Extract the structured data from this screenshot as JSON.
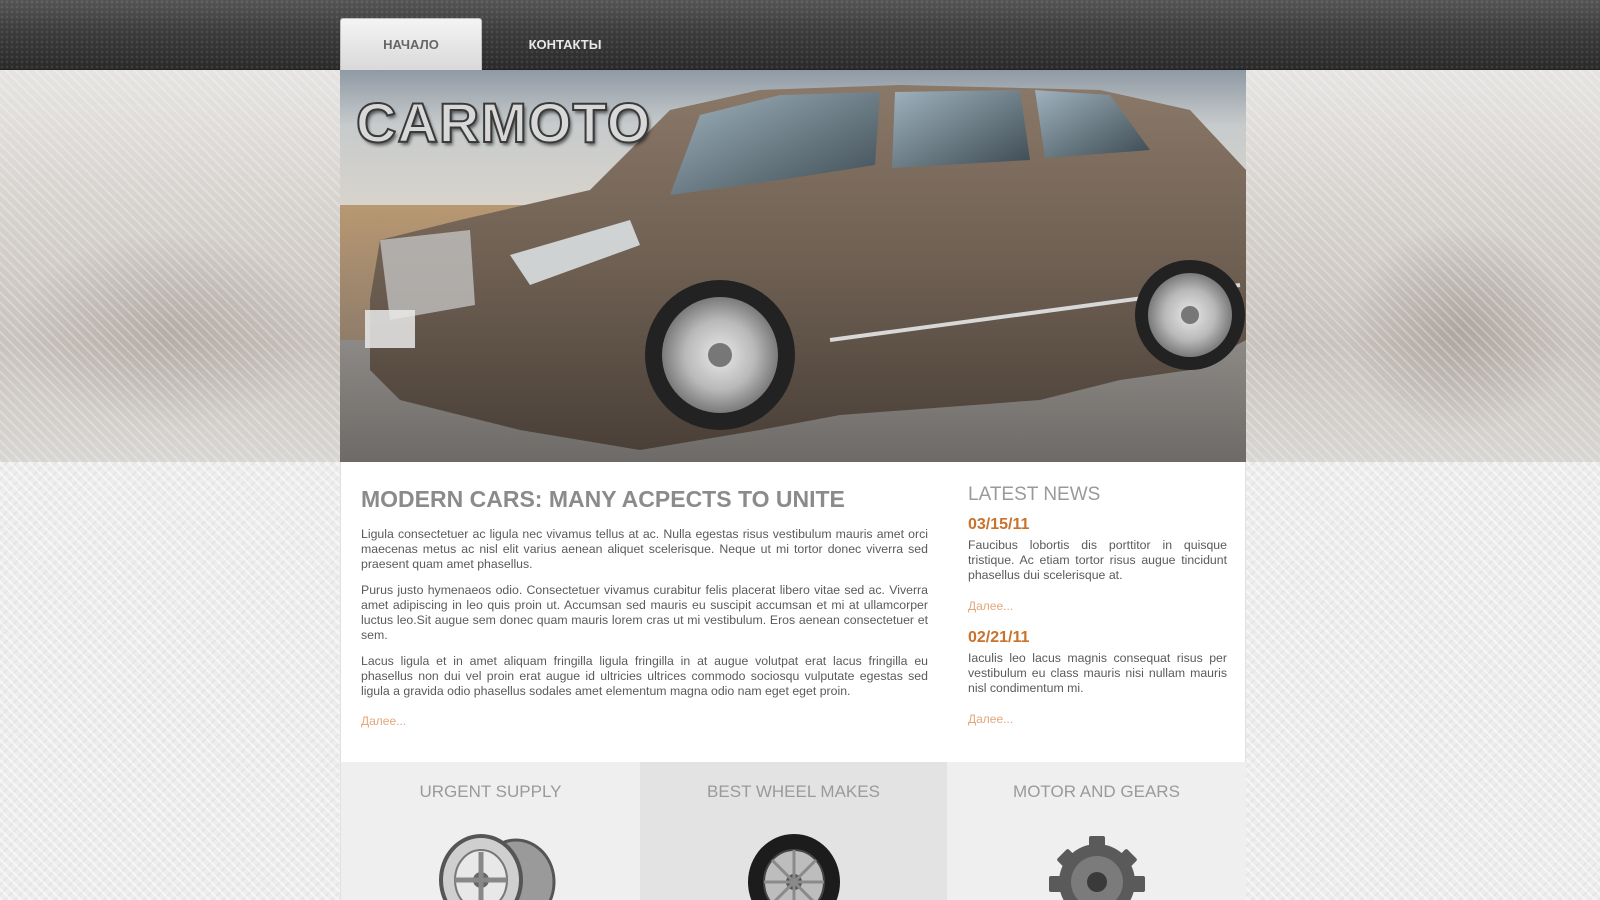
{
  "nav": {
    "items": [
      {
        "label": "НАЧАЛО",
        "active": true
      },
      {
        "label": "КОНТАКТЫ",
        "active": false
      }
    ]
  },
  "header": {
    "logo_text": "CARMOTO"
  },
  "main": {
    "title": "MODERN CARS: MANY ACPECTS TO UNITE",
    "paragraphs": [
      "Ligula consectetuer ac ligula nec vivamus tellus at ac. Nulla egestas risus vestibulum mauris amet orci maecenas metus ac nisl elit varius aenean aliquet scelerisque. Neque ut mi tortor donec viverra sed praesent quam amet phasellus.",
      "Purus justo hymenaeos odio. Consectetuer vivamus curabitur felis placerat libero vitae sed ac. Viverra amet adipiscing in leo quis proin ut. Accumsan sed mauris eu suscipit accumsan et mi at ullamcorper luctus leo.Sit augue sem donec quam mauris lorem cras ut mi vestibulum. Eros aenean consectetuer et sem.",
      "Lacus ligula et in amet aliquam fringilla ligula fringilla in at augue volutpat erat lacus fringilla eu phasellus non dui vel proin erat augue id ultricies ultrices commodo sociosqu vulputate egestas sed ligula a gravida odio phasellus sodales amet elementum magna odio nam eget eget proin."
    ],
    "more_label": "Далее..."
  },
  "news": {
    "title": "LATEST NEWS",
    "items": [
      {
        "date": "03/15/11",
        "text": "Faucibus lobortis dis porttitor in quisque tristique. Ac etiam tortor risus augue tincidunt phasellus dui scelerisque at.",
        "more_label": "Далее..."
      },
      {
        "date": "02/21/11",
        "text": "Iaculis leo lacus magnis consequat risus per vestibulum eu class mauris nisi nullam mauris nisl condimentum mi.",
        "more_label": "Далее..."
      }
    ]
  },
  "features": [
    {
      "title": "URGENT SUPPLY",
      "icon": "alloy-rims-icon"
    },
    {
      "title": "BEST WHEEL MAKES",
      "icon": "tire-icon"
    },
    {
      "title": "MOTOR AND GEARS",
      "icon": "gear-icon"
    }
  ],
  "colors": {
    "accent_date": "#c9722c",
    "link": "#e3a77c",
    "heading": "#8b8b8b"
  }
}
